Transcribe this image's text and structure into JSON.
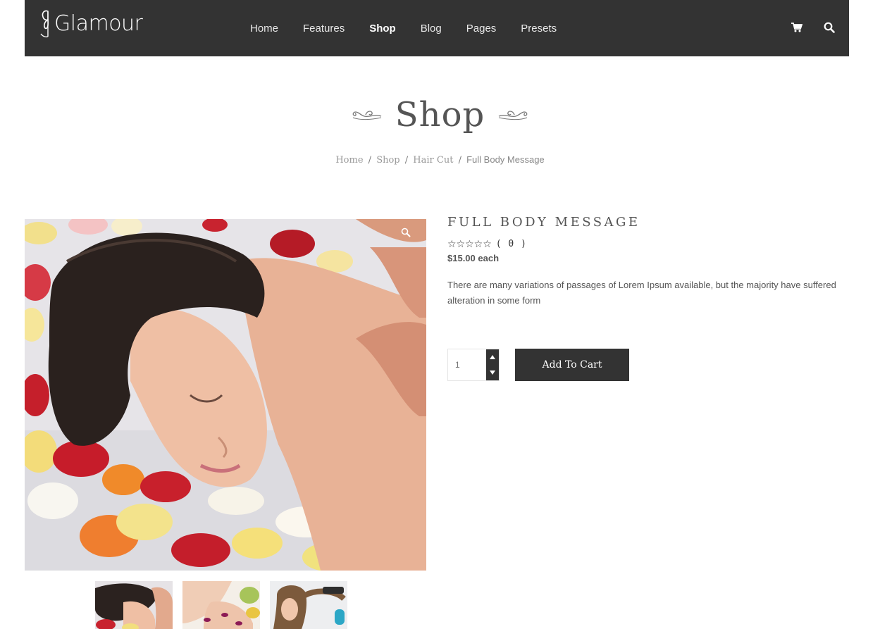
{
  "brand": {
    "name": "Glamour"
  },
  "nav": {
    "items": [
      {
        "label": "Home"
      },
      {
        "label": "Features"
      },
      {
        "label": "Shop"
      },
      {
        "label": "Blog"
      },
      {
        "label": "Pages"
      },
      {
        "label": "Presets"
      }
    ],
    "active": "Shop"
  },
  "header_icons": [
    "cart-icon",
    "search-icon"
  ],
  "page": {
    "title": "Shop",
    "breadcrumb": {
      "items": [
        "Home",
        "Shop",
        "Hair Cut"
      ],
      "separator": "/",
      "current": "Full Body Message"
    }
  },
  "product": {
    "title": "Full Body Message",
    "rating_stars": "☆☆☆☆☆",
    "review_count": "( 0 )",
    "price": "$15.00",
    "price_unit": "each",
    "description": "There are many variations of passages of Lorem Ipsum available, but the majority have suffered alteration in some form",
    "quantity_placeholder": "1",
    "add_to_cart_label": "Add To Cart"
  },
  "colors": {
    "header_bg": "#333333",
    "button_bg": "#333333",
    "text": "#555555"
  }
}
